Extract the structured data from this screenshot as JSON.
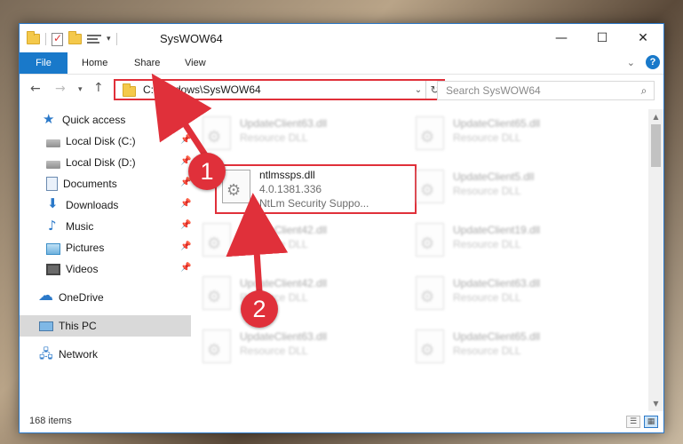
{
  "window": {
    "title": "SysWOW64",
    "controls": {
      "minimize": "—",
      "maximize": "☐",
      "close": "✕"
    }
  },
  "ribbon": {
    "tabs": [
      "File",
      "Home",
      "Share",
      "View"
    ],
    "help": "?"
  },
  "navigation": {
    "address_path": "C:\\Windows\\SysWOW64",
    "search_placeholder": "Search SysWOW64"
  },
  "sidebar": {
    "items": [
      {
        "label": "Quick access",
        "icon": "star-icon"
      },
      {
        "label": "Local Disk (C:)",
        "icon": "disk-icon",
        "pinned": true
      },
      {
        "label": "Local Disk (D:)",
        "icon": "disk-icon",
        "pinned": true
      },
      {
        "label": "Documents",
        "icon": "documents-icon",
        "pinned": true
      },
      {
        "label": "Downloads",
        "icon": "download-icon",
        "pinned": true
      },
      {
        "label": "Music",
        "icon": "music-icon",
        "pinned": true
      },
      {
        "label": "Pictures",
        "icon": "pictures-icon",
        "pinned": true
      },
      {
        "label": "Videos",
        "icon": "videos-icon",
        "pinned": true
      },
      {
        "label": "OneDrive",
        "icon": "cloud-icon"
      },
      {
        "label": "This PC",
        "icon": "computer-icon",
        "selected": true
      },
      {
        "label": "Network",
        "icon": "network-icon"
      }
    ]
  },
  "files": {
    "highlighted": {
      "name": "ntlmssps.dll",
      "version": "4.0.1381.336",
      "description": "NtLm Security Suppo..."
    },
    "tiles": [
      {
        "name": "UpdateClient63.dll",
        "type": "Resource DLL"
      },
      {
        "name": "UpdateClient65.dll",
        "type": "Resource DLL"
      },
      {
        "name": "UpdateClient5.dll",
        "type": "Resource DLL"
      },
      {
        "name": "UpdateClient42.dll",
        "type": "Resource DLL"
      },
      {
        "name": "UpdateClient19.dll",
        "type": "Resource DLL"
      },
      {
        "name": "UpdateClient42.dll",
        "type": "Resource DLL"
      },
      {
        "name": "UpdateClient63.dll",
        "type": "Resource DLL"
      },
      {
        "name": "UpdateClient63.dll",
        "type": "Resource DLL"
      },
      {
        "name": "UpdateClient65.dll",
        "type": "Resource DLL"
      }
    ]
  },
  "status": {
    "item_count": "168 items"
  },
  "annotations": {
    "step1": "1",
    "step2": "2",
    "color": "#e0303a"
  }
}
